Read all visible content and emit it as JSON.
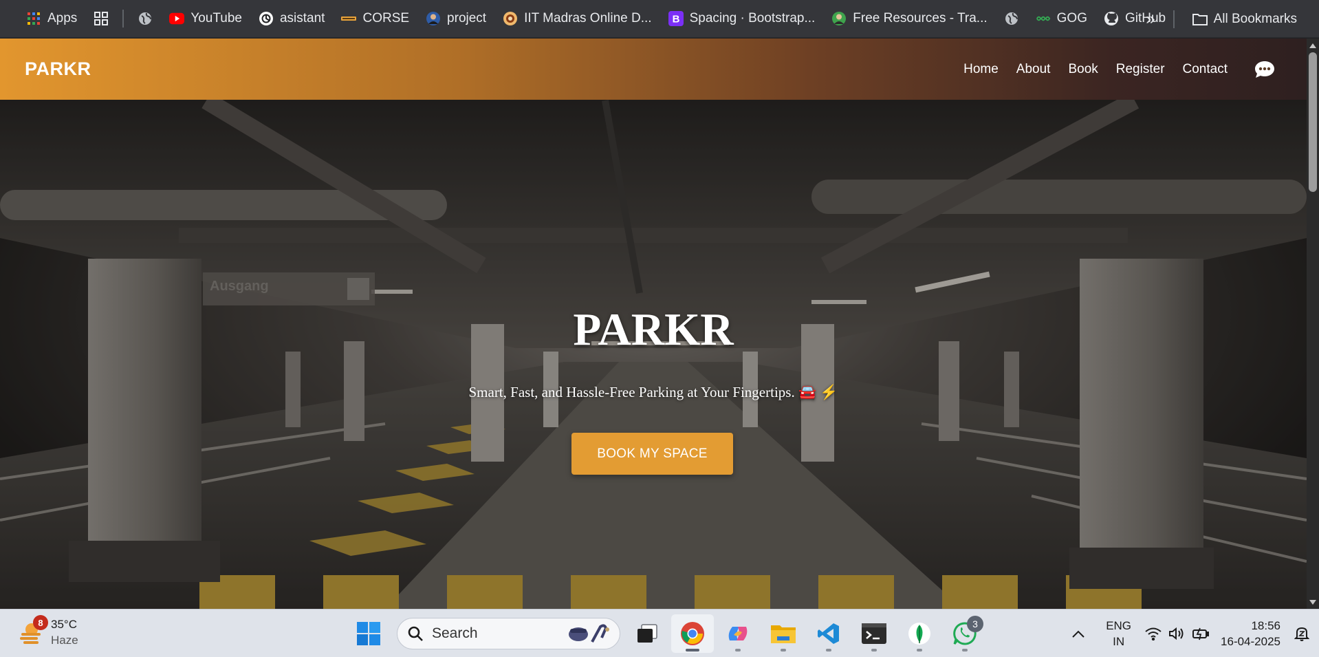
{
  "bookmarks": {
    "items": [
      {
        "label": "Apps",
        "icon": "apps-grid-icon"
      },
      {
        "label": "",
        "icon": "tab-groups-icon"
      },
      {
        "label": "",
        "icon": "globe-icon"
      },
      {
        "label": "YouTube",
        "icon": "youtube-icon"
      },
      {
        "label": "asistant",
        "icon": "openai-icon"
      },
      {
        "label": "CORSE",
        "icon": "course-icon"
      },
      {
        "label": "project",
        "icon": "avatar-icon"
      },
      {
        "label": "IIT Madras Online D...",
        "icon": "iitm-icon"
      },
      {
        "label": "Spacing · Bootstrap...",
        "icon": "bootstrap-icon"
      },
      {
        "label": "Free Resources - Tra...",
        "icon": "avatar-icon"
      },
      {
        "label": "",
        "icon": "globe-icon"
      },
      {
        "label": "GOG",
        "icon": "gog-icon"
      },
      {
        "label": "GitHub",
        "icon": "github-icon"
      }
    ],
    "overflow_label": "»",
    "all_bookmarks_label": "All Bookmarks"
  },
  "site": {
    "brand": "PARKR",
    "nav": [
      "Home",
      "About",
      "Book",
      "Register",
      "Contact"
    ],
    "chat_icon": "chat-bubble-icon",
    "accent": "#e39c33"
  },
  "hero": {
    "title": "PARKR",
    "subtitle": "Smart, Fast, and Hassle-Free Parking at Your Fingertips. 🚘 ⚡",
    "cta": "BOOK MY SPACE",
    "sign_text": "Ausgang"
  },
  "taskbar": {
    "weather": {
      "temp": "35°C",
      "condition": "Haze",
      "badge": "8"
    },
    "search_placeholder": "Search",
    "apps": [
      "task-view-icon",
      "chrome-icon",
      "copilot-icon",
      "file-explorer-icon",
      "vscode-icon",
      "terminal-icon",
      "mongodb-compass-icon",
      "whatsapp-icon"
    ],
    "whatsapp_badge": "3",
    "lang_line1": "ENG",
    "lang_line2": "IN",
    "time": "18:56",
    "date": "16-04-2025"
  }
}
